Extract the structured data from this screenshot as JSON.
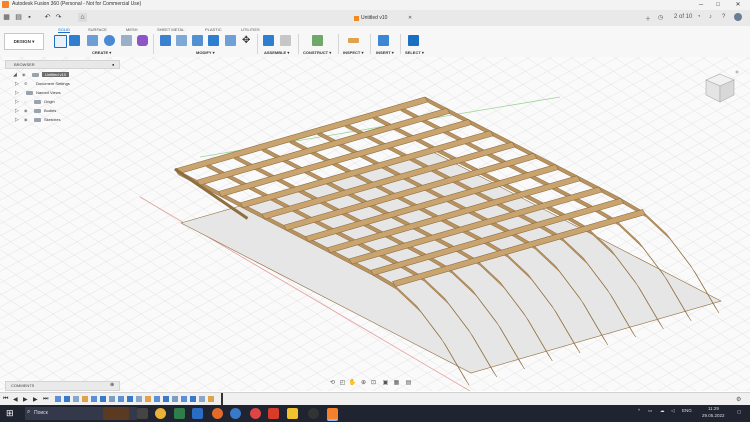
{
  "window": {
    "title": "Autodesk Fusion 360 (Personal - Not for Commercial Use)",
    "minimize": "─",
    "maximize": "□",
    "close": "✕"
  },
  "document": {
    "tab_title": "Untitled v10",
    "page_counter": "2 of 10"
  },
  "ribbon": {
    "workspace": "DESIGN ▾",
    "tabs": [
      "SOLID",
      "SURFACE",
      "MESH",
      "SHEET METAL",
      "PLASTIC",
      "UTILITIES"
    ],
    "active_tab": "SOLID",
    "groups": [
      "CREATE ▾",
      "MODIFY ▾",
      "ASSEMBLE ▾",
      "CONSTRUCT ▾",
      "INSPECT ▾",
      "INSERT ▾",
      "SELECT ▾"
    ]
  },
  "browser": {
    "header": "BROWSER",
    "items": [
      {
        "label": "Untitled v10"
      },
      {
        "label": "Document Settings"
      },
      {
        "label": "Named Views"
      },
      {
        "label": "Origin"
      },
      {
        "label": "Bodies"
      },
      {
        "label": "Sketches"
      }
    ]
  },
  "comments": {
    "label": "COMMENTS"
  },
  "taskbar": {
    "search_placeholder": "Поиск",
    "time": "11:29",
    "date": "29.05.2022",
    "lang": "ENG"
  },
  "colors": {
    "wood": "#b9935f",
    "wood_dark": "#8e6d3f",
    "accent": "#1b6fc2",
    "taskbar": "#1f2430",
    "fusion_orange": "#f5822a"
  }
}
